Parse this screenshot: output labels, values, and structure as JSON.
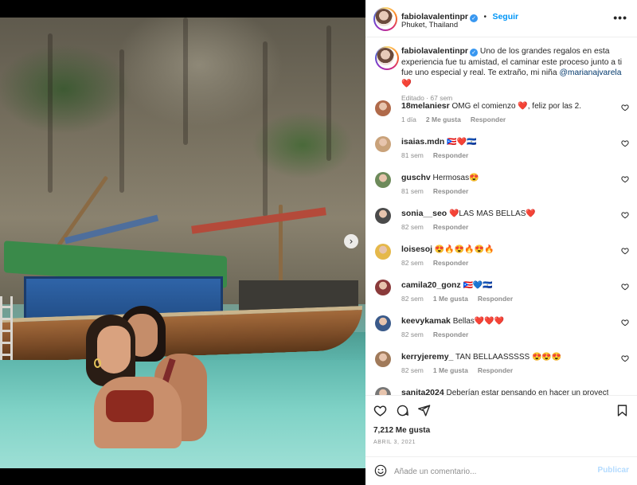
{
  "header": {
    "username": "fabiolavalentinpr",
    "follow_label": "Seguir",
    "separator": "•",
    "location": "Phuket, Thailand",
    "more_label": "•••"
  },
  "caption": {
    "username": "fabiolavalentinpr",
    "text": "Uno de los grandes regalos en esta experiencia fue tu amistad, el caminar este proceso junto a ti fue uno especial y real. Te extraño, mi niña",
    "mention": "@marianajvarela",
    "emoji": "❤️",
    "meta": "Editado · 67 sem"
  },
  "comments": [
    {
      "username": "18melaniesr",
      "text": "OMG el comienzo ❤️, feliz por las 2.",
      "time": "1 día",
      "likes": "2 Me gusta",
      "reply": "Responder",
      "avatar_color": "#b06a4a"
    },
    {
      "username": "isaias.mdn",
      "text": "🇵🇷❤️🇸🇻",
      "time": "81 sem",
      "likes": "",
      "reply": "Responder",
      "avatar_color": "#c9a27a"
    },
    {
      "username": "guschv",
      "text": "Hermosas😍",
      "time": "81 sem",
      "likes": "",
      "reply": "Responder",
      "avatar_color": "#6d8a5a"
    },
    {
      "username": "sonia__seo",
      "text": "❤️LAS MAS BELLAS❤️",
      "time": "82 sem",
      "likes": "",
      "reply": "Responder",
      "avatar_color": "#4a4a4a"
    },
    {
      "username": "loisesoj",
      "text": "😍🔥😍🔥😍🔥",
      "time": "82 sem",
      "likes": "",
      "reply": "Responder",
      "avatar_color": "#e5b84a"
    },
    {
      "username": "camila20_gonz",
      "text": "🇵🇷💙🇸🇻",
      "time": "82 sem",
      "likes": "1 Me gusta",
      "reply": "Responder",
      "avatar_color": "#8a3a3a"
    },
    {
      "username": "keevykamak",
      "text": "Bellas❤️❤️❤️",
      "time": "82 sem",
      "likes": "",
      "reply": "Responder",
      "avatar_color": "#3a5a8a"
    },
    {
      "username": "kerryjeremy_",
      "text": "TAN BELLAASSSSS 😍😍😍",
      "time": "82 sem",
      "likes": "1 Me gusta",
      "reply": "Responder",
      "avatar_color": "#a07a5a"
    },
    {
      "username": "sanita2024",
      "text": "Deberían estar pensando en hacer un proyecto",
      "time": "",
      "likes": "",
      "reply": "",
      "avatar_color": "#777777"
    }
  ],
  "actions": {
    "likes": "7,212 Me gusta",
    "date": "ABRIL 3, 2021"
  },
  "add_comment": {
    "placeholder": "Añade un comentario...",
    "publish_label": "Publicar"
  },
  "media": {
    "next_arrow": "›"
  },
  "colors": {
    "accent": "#0095f6",
    "verified": "#3897f0",
    "heart": "#ed4956",
    "muted": "#8e8e8e"
  }
}
